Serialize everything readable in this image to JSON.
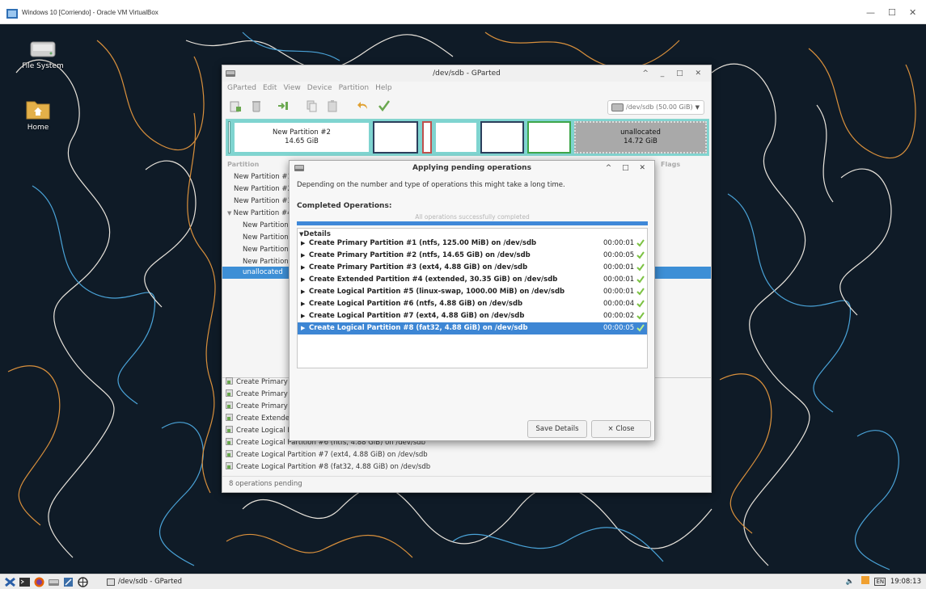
{
  "vbox": {
    "title": "Windows 10 [Corriendo] - Oracle VM VirtualBox",
    "minimize": "—",
    "maximize": "☐",
    "close": "✕"
  },
  "desktop": {
    "icons": [
      {
        "label": "File System"
      },
      {
        "label": "Home"
      }
    ]
  },
  "gparted": {
    "title": "/dev/sdb - GParted",
    "window_controls": "^ _ □ ✕",
    "menu": [
      "GParted",
      "Edit",
      "View",
      "Device",
      "Partition",
      "Help"
    ],
    "device": "/dev/sdb (50.00 GiB)",
    "map": {
      "p2_name": "New Partition #2",
      "p2_size": "14.65 GiB",
      "unalloc_name": "unallocated",
      "unalloc_size": "14.72 GiB"
    },
    "list_header": {
      "partition": "Partition",
      "flags": "Flags"
    },
    "partitions": [
      "New Partition #1",
      "New Partition #2",
      "New Partition #3",
      "New Partition #4",
      "New Partition",
      "New Partition",
      "New Partition",
      "New Partition",
      "unallocated"
    ],
    "operations": [
      "Create Primary P",
      "Create Primary P",
      "Create Primary P",
      "Create Extended",
      "Create Logical P",
      "Create Logical Partition #6 (ntfs, 4.88 GiB) on /dev/sdb",
      "Create Logical Partition #7 (ext4, 4.88 GiB) on /dev/sdb",
      "Create Logical Partition #8 (fat32, 4.88 GiB) on /dev/sdb"
    ],
    "status": "8 operations pending"
  },
  "dialog": {
    "title": "Applying pending operations",
    "window_controls": "^ □ ✕",
    "message": "Depending on the number and type of operations this might take a long time.",
    "completed_label": "Completed Operations:",
    "progress_text": "All operations successfully completed",
    "progress_fraction": 1.0,
    "details_label": "Details",
    "rows": [
      {
        "text": "Create Primary Partition #1 (ntfs, 125.00 MiB) on /dev/sdb",
        "time": "00:00:01"
      },
      {
        "text": "Create Primary Partition #2 (ntfs, 14.65 GiB) on /dev/sdb",
        "time": "00:00:05"
      },
      {
        "text": "Create Primary Partition #3 (ext4, 4.88 GiB) on /dev/sdb",
        "time": "00:00:01"
      },
      {
        "text": "Create Extended Partition #4 (extended, 30.35 GiB) on /dev/sdb",
        "time": "00:00:01"
      },
      {
        "text": "Create Logical Partition #5 (linux-swap, 1000.00 MiB) on /dev/sdb",
        "time": "00:00:01"
      },
      {
        "text": "Create Logical Partition #6 (ntfs, 4.88 GiB) on /dev/sdb",
        "time": "00:00:04"
      },
      {
        "text": "Create Logical Partition #7 (ext4, 4.88 GiB) on /dev/sdb",
        "time": "00:00:02"
      },
      {
        "text": "Create Logical Partition #8 (fat32, 4.88 GiB) on /dev/sdb",
        "time": "00:00:05"
      }
    ],
    "save_label": "Save Details",
    "close_label": "× Close"
  },
  "taskbar": {
    "task": "/dev/sdb - GParted",
    "clock": "19:08:13",
    "kbd": "EN"
  }
}
